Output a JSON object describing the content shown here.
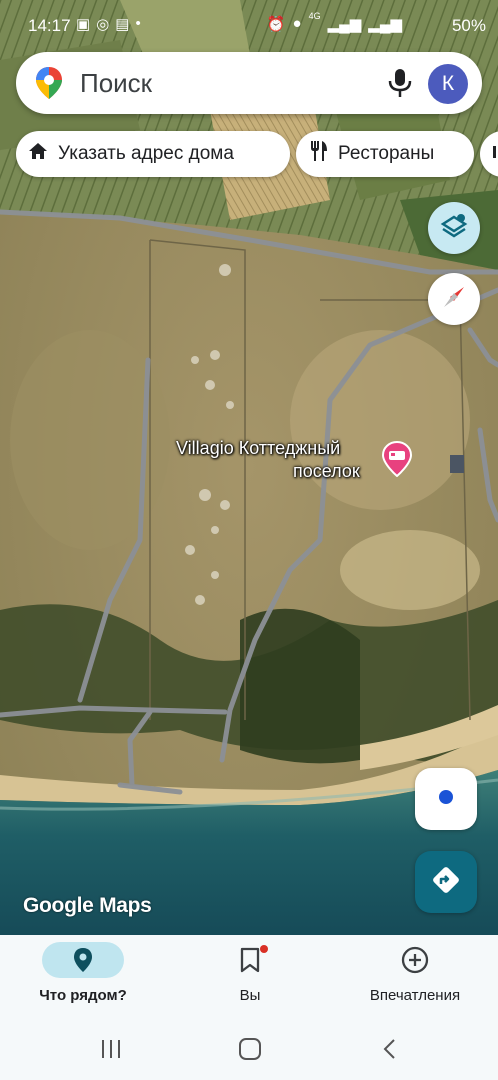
{
  "status_bar": {
    "time": "14:17",
    "battery": "50%",
    "network": "4G"
  },
  "search": {
    "placeholder": "Поиск",
    "avatar_letter": "К"
  },
  "chips": [
    {
      "label": "Указать адрес дома",
      "icon": "home-icon"
    },
    {
      "label": "Рестораны",
      "icon": "restaurant-icon"
    }
  ],
  "map": {
    "place_name_line1": "Villagio Коттеджный",
    "place_name_line2": "поселок",
    "place_category_icon": "hotel-icon",
    "attribution": "Google Maps",
    "marker_color": "#e8417f"
  },
  "bottom_nav": {
    "items": [
      {
        "label": "Что рядом?",
        "icon": "location-pin-icon",
        "active": true
      },
      {
        "label": "Вы",
        "icon": "bookmark-icon",
        "active": false
      },
      {
        "label": "Впечатления",
        "icon": "add-circle-icon",
        "active": false
      }
    ]
  },
  "colors": {
    "accent": "#0e6a80",
    "active_pill": "#bfe5ef",
    "avatar": "#4c5bbd"
  }
}
